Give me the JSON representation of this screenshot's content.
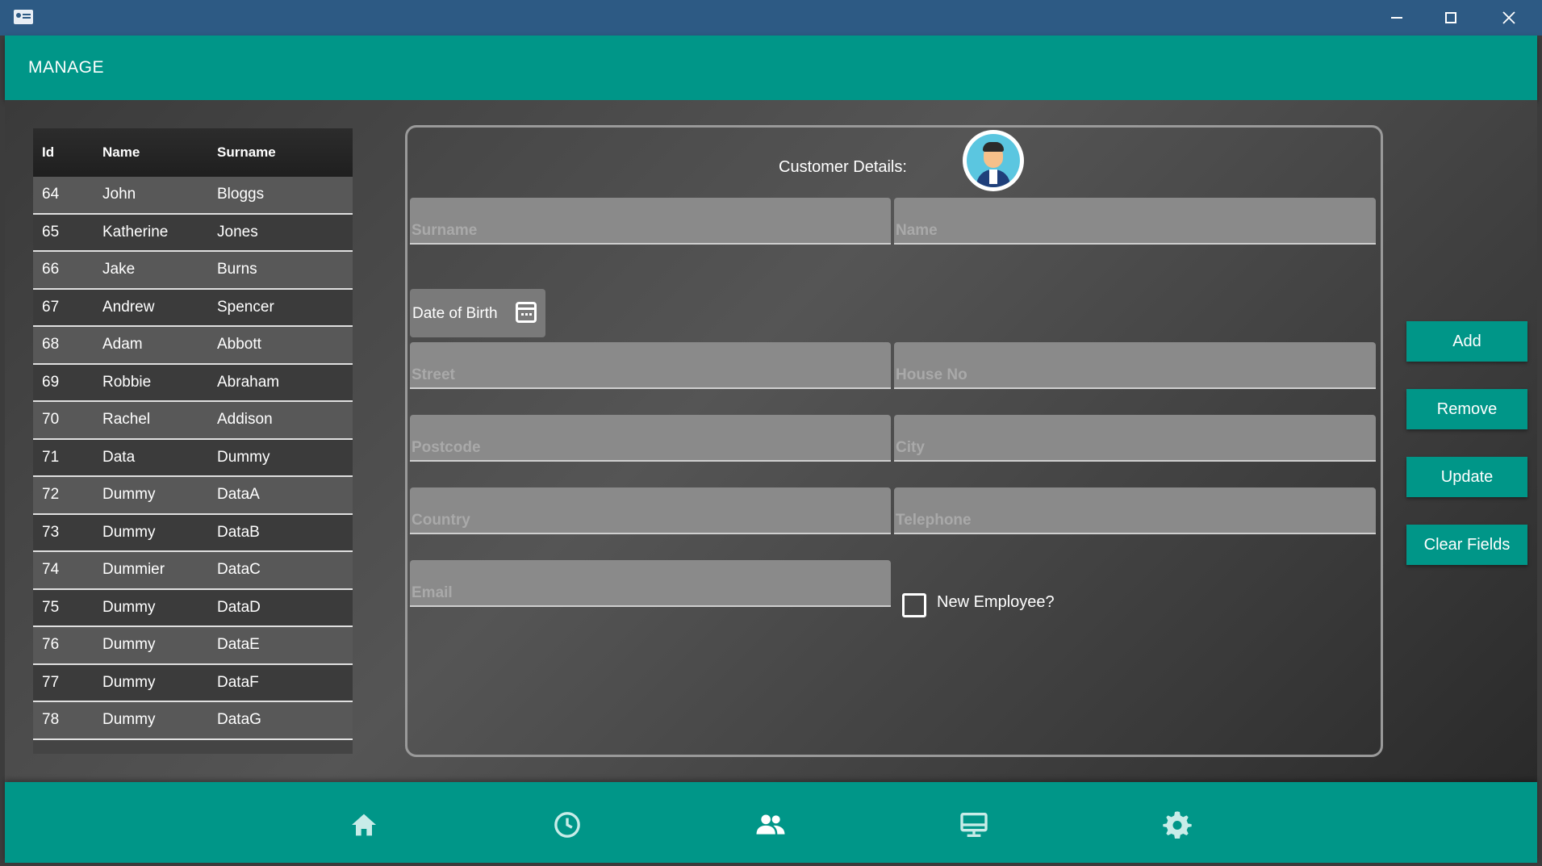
{
  "window": {
    "controls": {
      "minimize": "minimize",
      "maximize": "maximize",
      "close": "close"
    }
  },
  "header": {
    "title": "MANAGE"
  },
  "table": {
    "columns": [
      "Id",
      "Name",
      "Surname"
    ],
    "rows": [
      [
        "64",
        "John",
        "Bloggs"
      ],
      [
        "65",
        "Katherine",
        "Jones"
      ],
      [
        "66",
        "Jake",
        "Burns"
      ],
      [
        "67",
        "Andrew",
        "Spencer"
      ],
      [
        "68",
        "Adam",
        "Abbott"
      ],
      [
        "69",
        "Robbie",
        "Abraham"
      ],
      [
        "70",
        "Rachel",
        "Addison"
      ],
      [
        "71",
        "Data",
        "Dummy"
      ],
      [
        "72",
        "Dummy",
        "DataA"
      ],
      [
        "73",
        "Dummy",
        "DataB"
      ],
      [
        "74",
        "Dummier",
        "DataC"
      ],
      [
        "75",
        "Dummy",
        "DataD"
      ],
      [
        "76",
        "Dummy",
        "DataE"
      ],
      [
        "77",
        "Dummy",
        "DataF"
      ],
      [
        "78",
        "Dummy",
        "DataG"
      ]
    ]
  },
  "form": {
    "title": "Customer Details:",
    "fields": {
      "surname": {
        "placeholder": "Surname",
        "value": ""
      },
      "name": {
        "placeholder": "Name",
        "value": ""
      },
      "date_of_birth": "Date of Birth",
      "street": {
        "placeholder": "Street",
        "value": ""
      },
      "house_no": {
        "placeholder": "House No",
        "value": ""
      },
      "postcode": {
        "placeholder": "Postcode",
        "value": ""
      },
      "city": {
        "placeholder": "City",
        "value": ""
      },
      "country": {
        "placeholder": "Country",
        "value": ""
      },
      "telephone": {
        "placeholder": "Telephone",
        "value": ""
      },
      "email": {
        "placeholder": "Email",
        "value": ""
      }
    },
    "new_employee": {
      "label": "New Employee?",
      "checked": false
    }
  },
  "actions": {
    "add": "Add",
    "remove": "Remove",
    "update": "Update",
    "clear": "Clear Fields"
  },
  "nav": {
    "items": [
      "home-icon",
      "history-icon",
      "people-icon",
      "display-icon",
      "settings-icon"
    ],
    "active": "people-icon"
  },
  "colors": {
    "titlebar": "#2d5a84",
    "accent": "#009688",
    "background": "#3c3c3c"
  }
}
